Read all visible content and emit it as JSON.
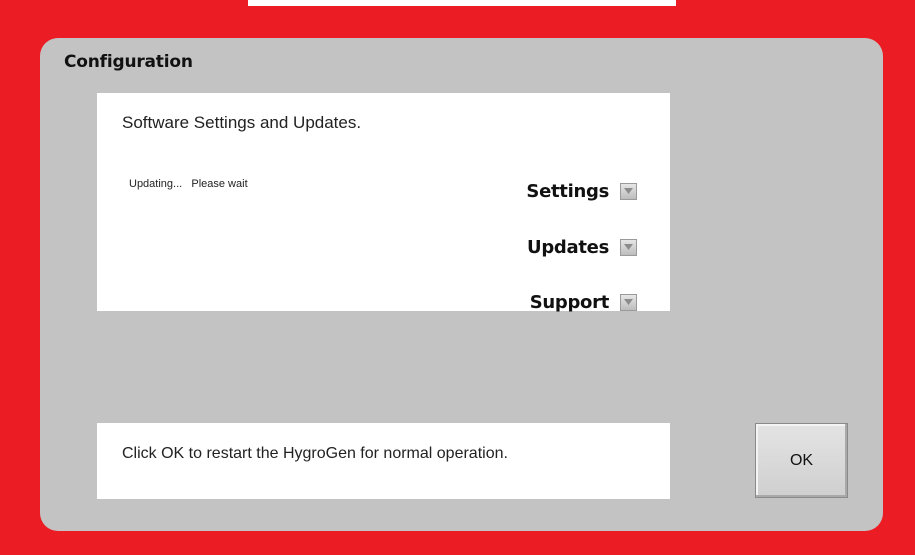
{
  "window": {
    "title": "Configuration"
  },
  "settings_panel": {
    "heading": "Software Settings and Updates.",
    "status": "Updating...   Please wait",
    "menu": [
      {
        "label": "Settings",
        "icon": "dropdown-arrow-icon"
      },
      {
        "label": "Updates",
        "icon": "dropdown-arrow-icon"
      },
      {
        "label": "Support",
        "icon": "dropdown-arrow-icon"
      }
    ]
  },
  "message_panel": {
    "text": "Click OK to restart the HygroGen for normal operation."
  },
  "ok_button": {
    "label": "OK"
  },
  "colors": {
    "frame": "#ec1c24",
    "panel": "#c3c3c3",
    "box": "#ffffff"
  }
}
